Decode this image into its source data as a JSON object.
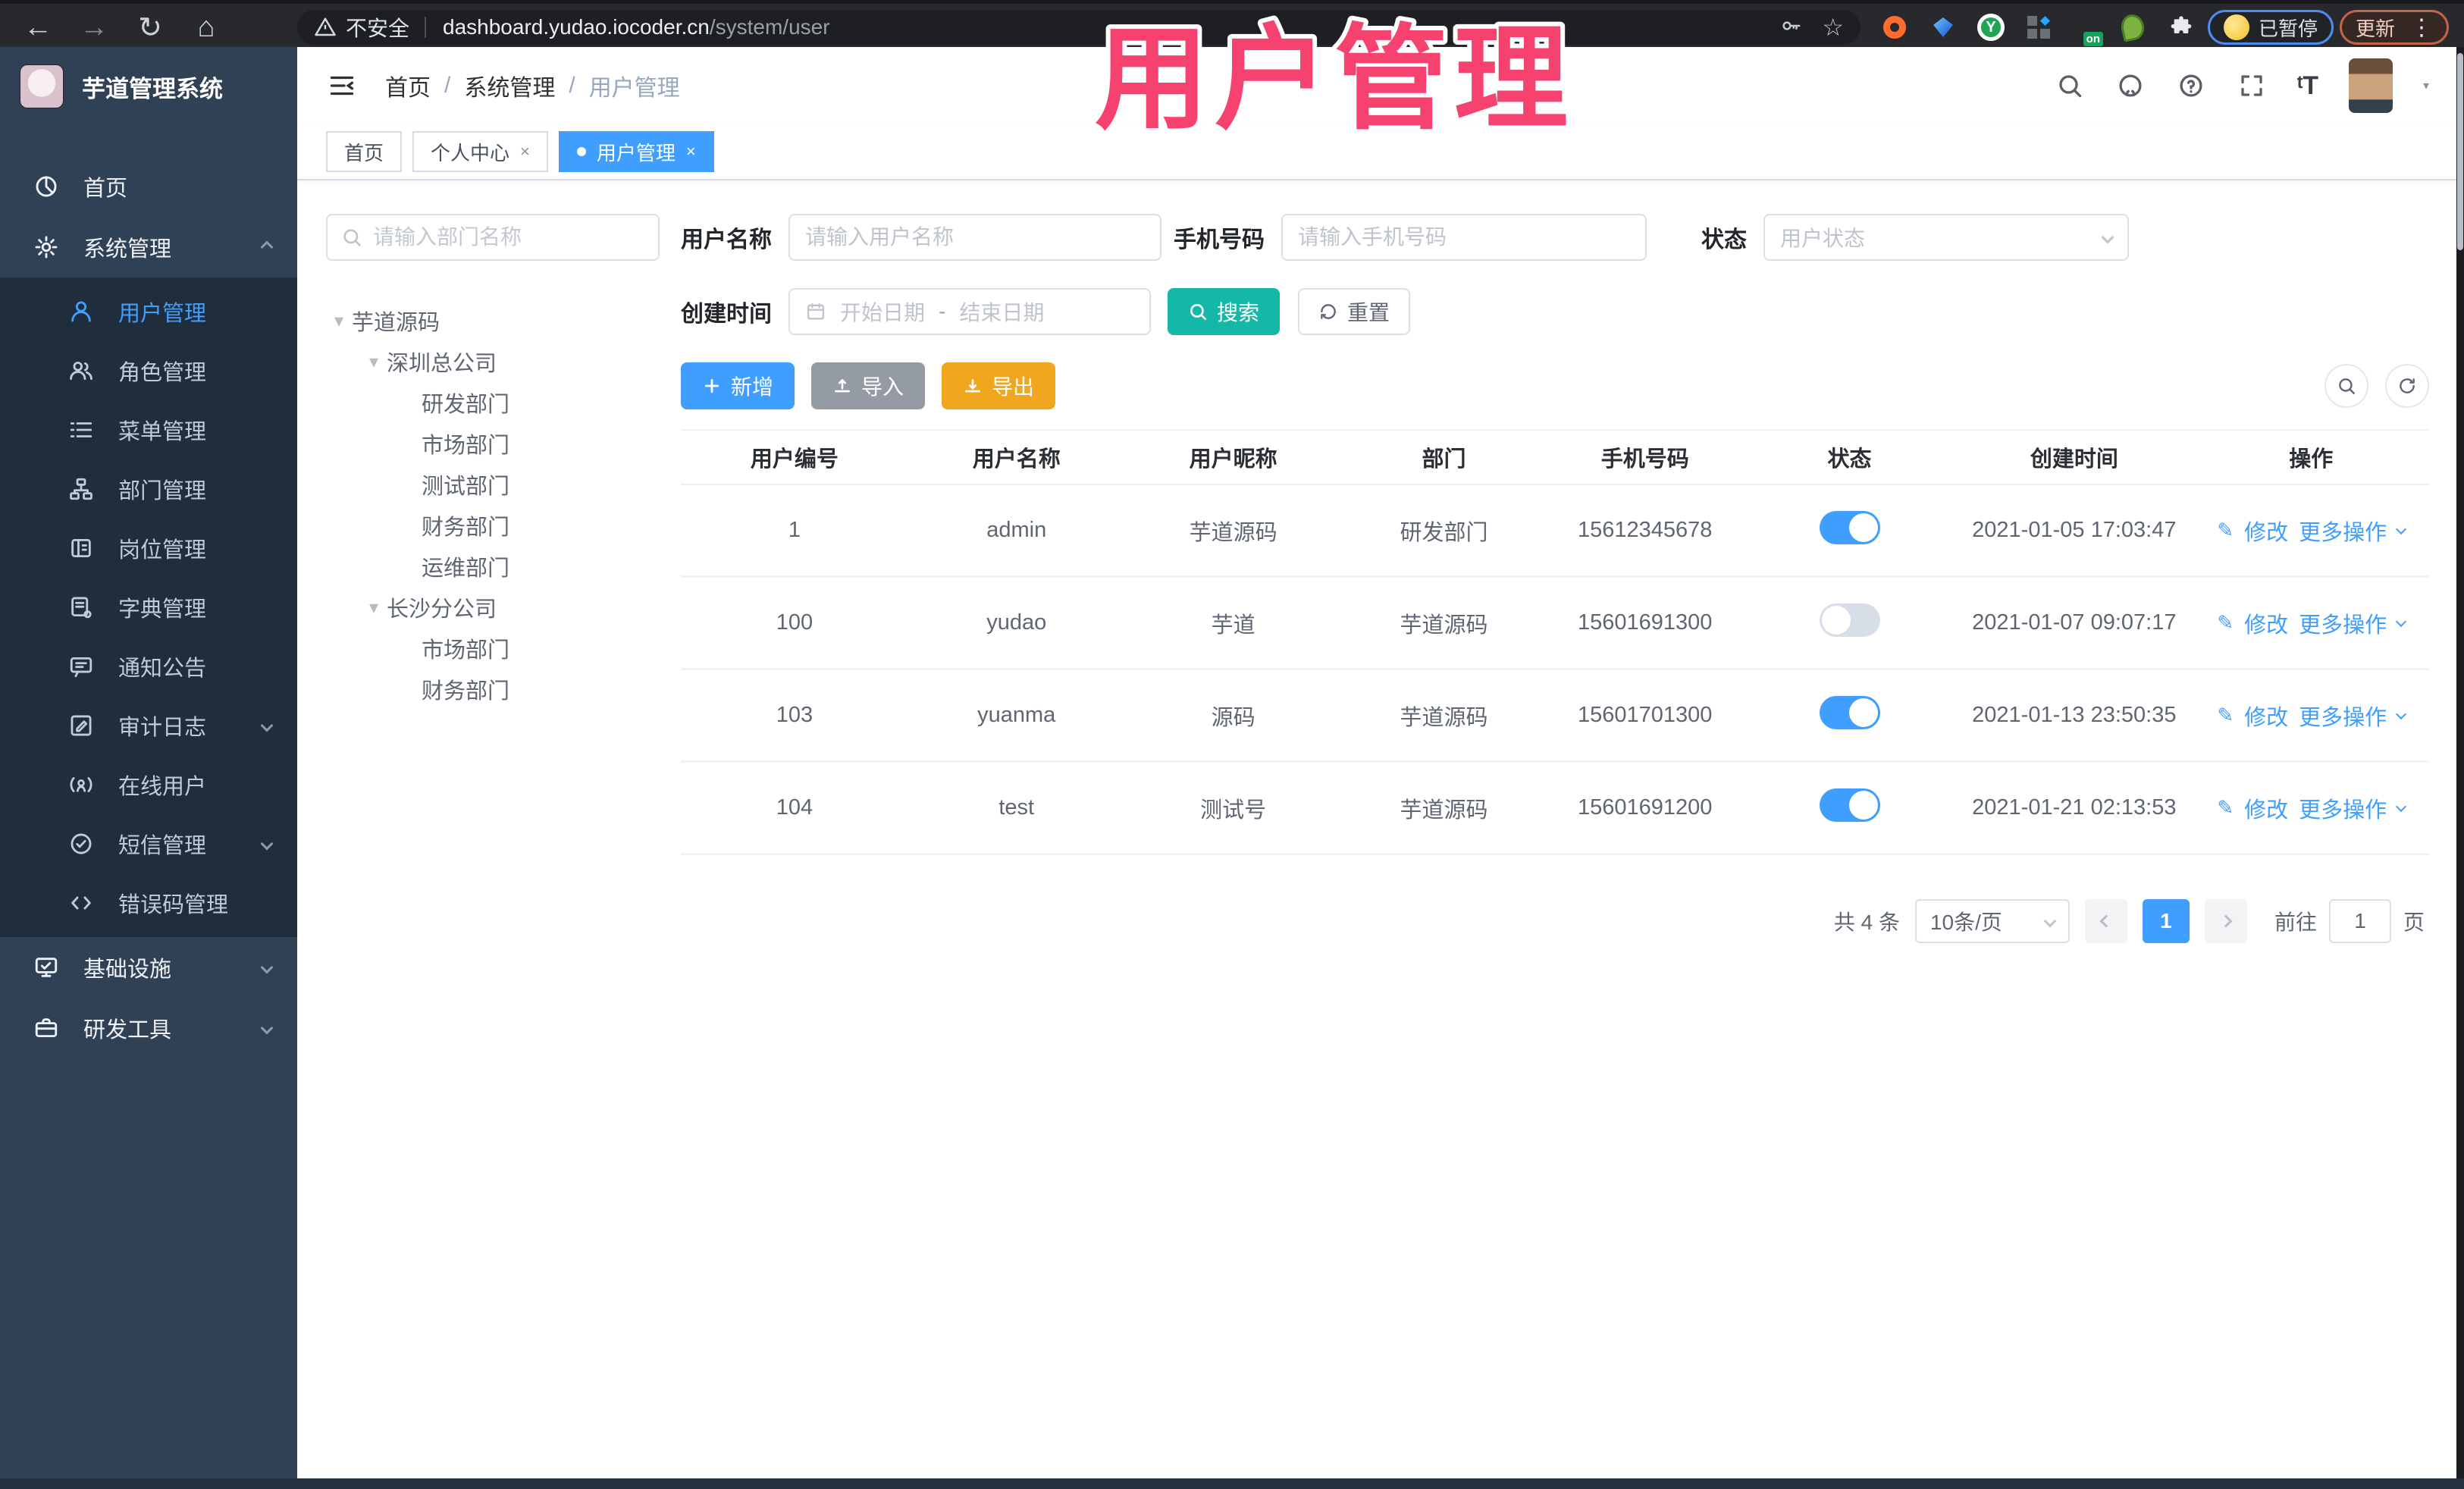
{
  "browser": {
    "security_label": "不安全",
    "url_host": "dashboard.yudao.iocoder.cn",
    "url_path": "/system/user",
    "paused_badge": "已暂停",
    "update_button": "更新"
  },
  "overlay": {
    "title": "用户管理"
  },
  "colors": {
    "accent_blue": "#409eff",
    "search_teal": "#14b8a6",
    "export_orange": "#f0a71f",
    "import_gray": "#959ba3",
    "overlay_pink": "#f5426e",
    "sidebar_bg": "#304156",
    "submenu_bg": "#1f2d3d"
  },
  "sidebar": {
    "app_title": "芋道管理系统",
    "items": [
      {
        "id": "home",
        "label": "首页",
        "icon": "dashboard",
        "level": 0
      },
      {
        "id": "system",
        "label": "系统管理",
        "icon": "gear",
        "level": 0,
        "arrow": "up"
      },
      {
        "id": "user",
        "label": "用户管理",
        "icon": "user",
        "level": 1,
        "active": true
      },
      {
        "id": "role",
        "label": "角色管理",
        "icon": "users",
        "level": 1
      },
      {
        "id": "menu",
        "label": "菜单管理",
        "icon": "menu",
        "level": 1
      },
      {
        "id": "dept",
        "label": "部门管理",
        "icon": "tree",
        "level": 1
      },
      {
        "id": "post",
        "label": "岗位管理",
        "icon": "badge",
        "level": 1
      },
      {
        "id": "dict",
        "label": "字典管理",
        "icon": "book",
        "level": 1
      },
      {
        "id": "notice",
        "label": "通知公告",
        "icon": "message",
        "level": 1
      },
      {
        "id": "audit",
        "label": "审计日志",
        "icon": "log",
        "level": 1,
        "arrow": "down"
      },
      {
        "id": "online",
        "label": "在线用户",
        "icon": "online",
        "level": 1
      },
      {
        "id": "sms",
        "label": "短信管理",
        "icon": "sms",
        "level": 1,
        "arrow": "down"
      },
      {
        "id": "errcode",
        "label": "错误码管理",
        "icon": "code",
        "level": 1
      },
      {
        "id": "infra",
        "label": "基础设施",
        "icon": "monitor",
        "level": 0,
        "arrow": "down"
      },
      {
        "id": "tools",
        "label": "研发工具",
        "icon": "briefcase",
        "level": 0,
        "arrow": "down"
      }
    ]
  },
  "header": {
    "breadcrumb": [
      "首页",
      "系统管理",
      "用户管理"
    ]
  },
  "tabs": [
    {
      "label": "首页",
      "closable": false,
      "active": false
    },
    {
      "label": "个人中心",
      "closable": true,
      "active": false
    },
    {
      "label": "用户管理",
      "closable": true,
      "active": true
    }
  ],
  "tree_panel": {
    "search_placeholder": "请输入部门名称",
    "nodes": [
      {
        "label": "芋道源码",
        "level": 0,
        "expanded": true
      },
      {
        "label": "深圳总公司",
        "level": 1,
        "expanded": true
      },
      {
        "label": "研发部门",
        "level": 2
      },
      {
        "label": "市场部门",
        "level": 2
      },
      {
        "label": "测试部门",
        "level": 2
      },
      {
        "label": "财务部门",
        "level": 2
      },
      {
        "label": "运维部门",
        "level": 2
      },
      {
        "label": "长沙分公司",
        "level": 1,
        "expanded": true
      },
      {
        "label": "市场部门",
        "level": 2
      },
      {
        "label": "财务部门",
        "level": 2
      }
    ]
  },
  "filters": {
    "username_label": "用户名称",
    "username_placeholder": "请输入用户名称",
    "mobile_label": "手机号码",
    "mobile_placeholder": "请输入手机号码",
    "status_label": "状态",
    "status_placeholder": "用户状态",
    "create_time_label": "创建时间",
    "date_start_placeholder": "开始日期",
    "date_separator": "-",
    "date_end_placeholder": "结束日期",
    "search_button": "搜索",
    "reset_button": "重置"
  },
  "toolbar": {
    "add_label": "新增",
    "import_label": "导入",
    "export_label": "导出"
  },
  "table": {
    "columns": [
      "用户编号",
      "用户名称",
      "用户昵称",
      "部门",
      "手机号码",
      "状态",
      "创建时间",
      "操作"
    ],
    "row_actions": {
      "edit": "修改",
      "more": "更多操作"
    },
    "rows": [
      {
        "id": "1",
        "username": "admin",
        "nickname": "芋道源码",
        "dept": "研发部门",
        "mobile": "15612345678",
        "status_on": true,
        "created": "2021-01-05 17:03:47"
      },
      {
        "id": "100",
        "username": "yudao",
        "nickname": "芋道",
        "dept": "芋道源码",
        "mobile": "15601691300",
        "status_on": false,
        "created": "2021-01-07 09:07:17"
      },
      {
        "id": "103",
        "username": "yuanma",
        "nickname": "源码",
        "dept": "芋道源码",
        "mobile": "15601701300",
        "status_on": true,
        "created": "2021-01-13 23:50:35"
      },
      {
        "id": "104",
        "username": "test",
        "nickname": "测试号",
        "dept": "芋道源码",
        "mobile": "15601691200",
        "status_on": true,
        "created": "2021-01-21 02:13:53"
      }
    ]
  },
  "pagination": {
    "total_text": "共 4 条",
    "page_size": "10条/页",
    "current_page": "1",
    "goto_label": "前往",
    "goto_value": "1",
    "page_unit": "页"
  }
}
